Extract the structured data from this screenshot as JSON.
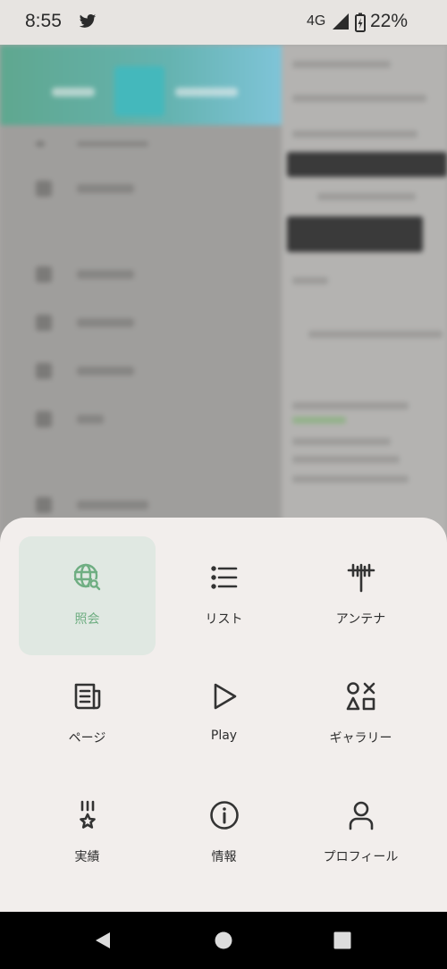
{
  "status_bar": {
    "time": "8:55",
    "network": "4G",
    "battery": "22%",
    "notification_icon": "bird-icon"
  },
  "menu": {
    "items": [
      {
        "label": "照会",
        "icon": "globe-search-icon",
        "active": true
      },
      {
        "label": "リスト",
        "icon": "list-icon",
        "active": false
      },
      {
        "label": "アンテナ",
        "icon": "antenna-icon",
        "active": false
      },
      {
        "label": "ページ",
        "icon": "news-page-icon",
        "active": false
      },
      {
        "label": "Play",
        "icon": "play-icon",
        "active": false
      },
      {
        "label": "ギャラリー",
        "icon": "shapes-icon",
        "active": false
      },
      {
        "label": "実績",
        "icon": "medal-icon",
        "active": false
      },
      {
        "label": "情報",
        "icon": "info-icon",
        "active": false
      },
      {
        "label": "プロフィール",
        "icon": "user-icon",
        "active": false
      }
    ]
  },
  "colors": {
    "accent": "#6fae82",
    "active_bg": "#e0e8e2",
    "sheet_bg": "#f2eeec",
    "icon": "#333333"
  },
  "nav_bar": {
    "back": "back-icon",
    "home": "home-icon",
    "recents": "recents-icon"
  }
}
